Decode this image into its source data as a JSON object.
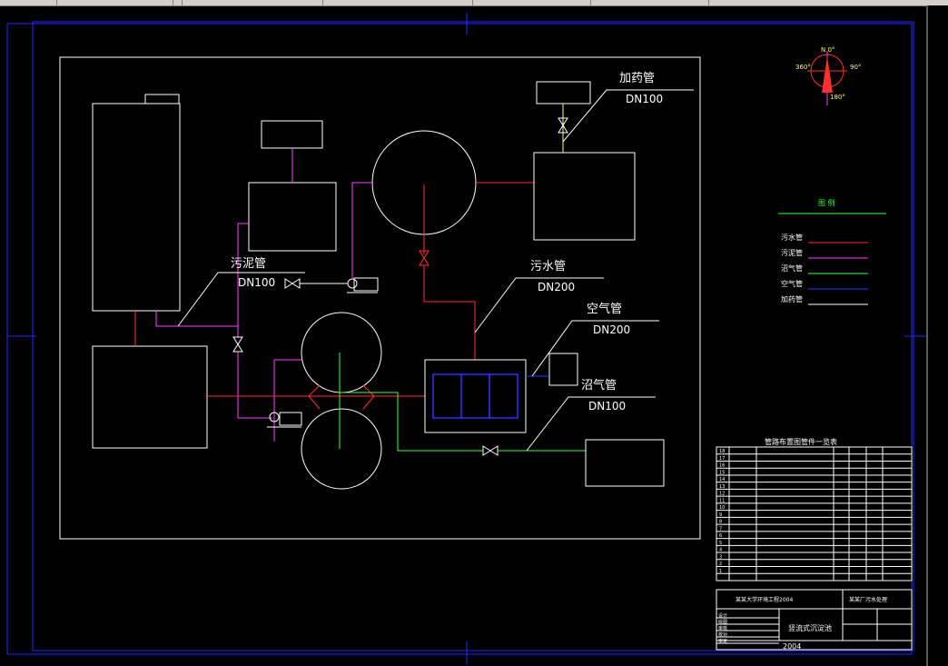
{
  "diagram": {
    "pipes": {
      "sludge": {
        "label": "污泥管",
        "size": "DN100"
      },
      "sewage": {
        "label": "污水管",
        "size": "DN200"
      },
      "air": {
        "label": "空气管",
        "size": "DN200"
      },
      "biogas": {
        "label": "沼气管",
        "size": "DN100"
      },
      "dosing": {
        "label": "加药管",
        "size": "DN100"
      }
    },
    "compass": {
      "north": "N 0°",
      "west": "360°",
      "east": "90°",
      "south": "180°"
    },
    "legend": {
      "title": "图 例",
      "items": [
        {
          "label": "污水管",
          "color": "#ff3030"
        },
        {
          "label": "污泥管",
          "color": "#ff40ff"
        },
        {
          "label": "沼气管",
          "color": "#40ff40"
        },
        {
          "label": "空气管",
          "color": "#3030ff"
        },
        {
          "label": "加药管",
          "color": "#ffffff"
        }
      ]
    },
    "parts_table": {
      "title": "管路布置图管件一览表",
      "rows": [
        "18",
        "17",
        "16",
        "15",
        "14",
        "13",
        "12",
        "11",
        "10",
        "9",
        "8",
        "7",
        "6",
        "5",
        "4",
        "3",
        "2",
        "1"
      ]
    },
    "title_block": {
      "school": "某某大学环境工程2004",
      "org": "某某厂污水处理",
      "drawing_name": "竖流式沉淀池",
      "year": "2004",
      "roles": [
        "设计",
        "绘图",
        "审核",
        "校对",
        "审定"
      ]
    },
    "colors": {
      "sewage": "#ff3030",
      "sludge": "#ff40ff",
      "biogas": "#40ff40",
      "air": "#3030ff",
      "outline": "#ffffff",
      "frame": "#2828ff"
    }
  }
}
